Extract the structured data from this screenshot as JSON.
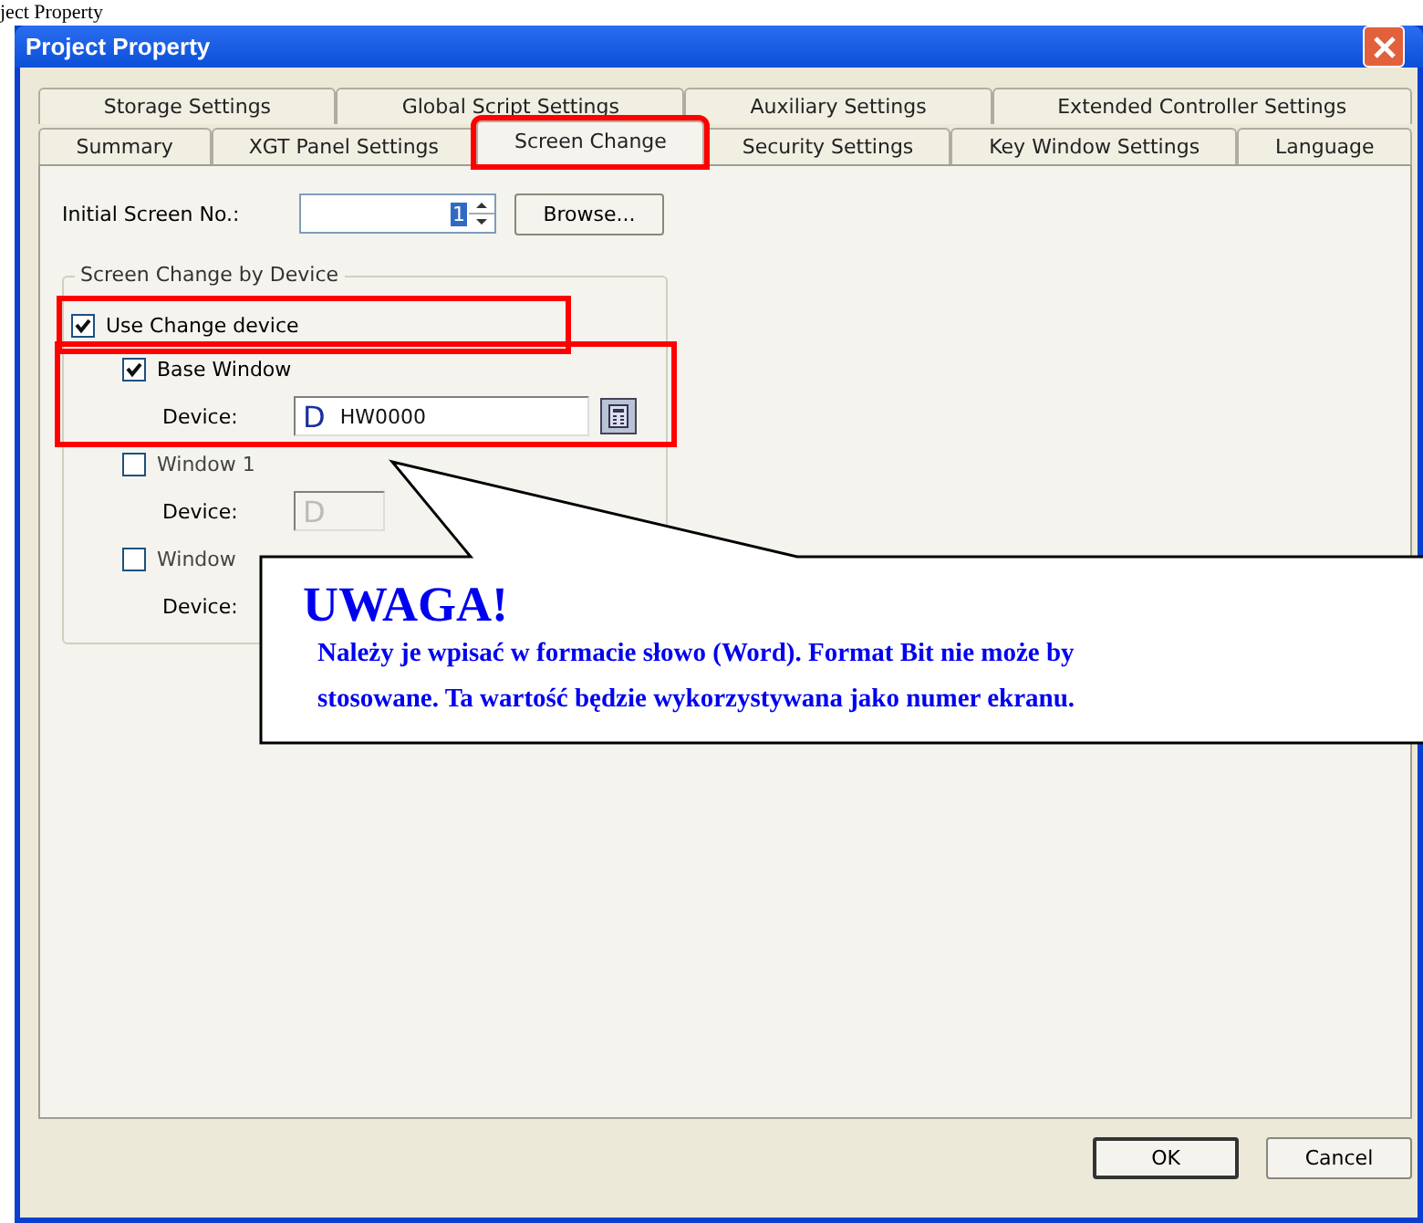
{
  "caption": "ject Property",
  "window": {
    "title": "Project Property"
  },
  "tab_rows": [
    [
      {
        "label": "Storage Settings",
        "selected": false,
        "highlighted": false
      },
      {
        "label": "Global Script Settings",
        "selected": false,
        "highlighted": false
      },
      {
        "label": "Auxiliary Settings",
        "selected": false,
        "highlighted": false
      },
      {
        "label": "Extended Controller Settings",
        "selected": false,
        "highlighted": false
      }
    ],
    [
      {
        "label": "Summary",
        "selected": false,
        "highlighted": false
      },
      {
        "label": "XGT Panel Settings",
        "selected": false,
        "highlighted": false
      },
      {
        "label": "Screen Change",
        "selected": true,
        "highlighted": true
      },
      {
        "label": "Security Settings",
        "selected": false,
        "highlighted": false
      },
      {
        "label": "Key Window Settings",
        "selected": false,
        "highlighted": false
      },
      {
        "label": "Language",
        "selected": false,
        "highlighted": false
      }
    ]
  ],
  "initial_screen": {
    "label": "Initial Screen No.:",
    "value": "1",
    "button": "Browse..."
  },
  "group": {
    "title": "Screen Change by Device",
    "use_device": {
      "label": "Use Change device",
      "checked": true,
      "highlighted": true
    },
    "windows": [
      {
        "label": "Base Window",
        "checked": true,
        "disabled": false,
        "highlighted": true,
        "device_label": "Device:",
        "device_prefix": "D",
        "value": "HW0000",
        "lookup_button": true
      },
      {
        "label": "Window 1",
        "checked": false,
        "disabled": true,
        "highlighted": false,
        "device_label": "Device:",
        "device_prefix": "D",
        "lookup_button": false
      },
      {
        "label": "Window",
        "checked": false,
        "disabled": true,
        "highlighted": false,
        "device_label": "Device:",
        "lookup_button": false
      }
    ]
  },
  "callout": {
    "heading": "UWAGA!",
    "lines": [
      "Należy je wpisać w formacie słowo (Word). Format Bit nie może by",
      "stosowane. Ta wartość będzie wykorzystywana jako numer ekranu."
    ]
  },
  "buttons": [
    "OK",
    "Cancel"
  ]
}
